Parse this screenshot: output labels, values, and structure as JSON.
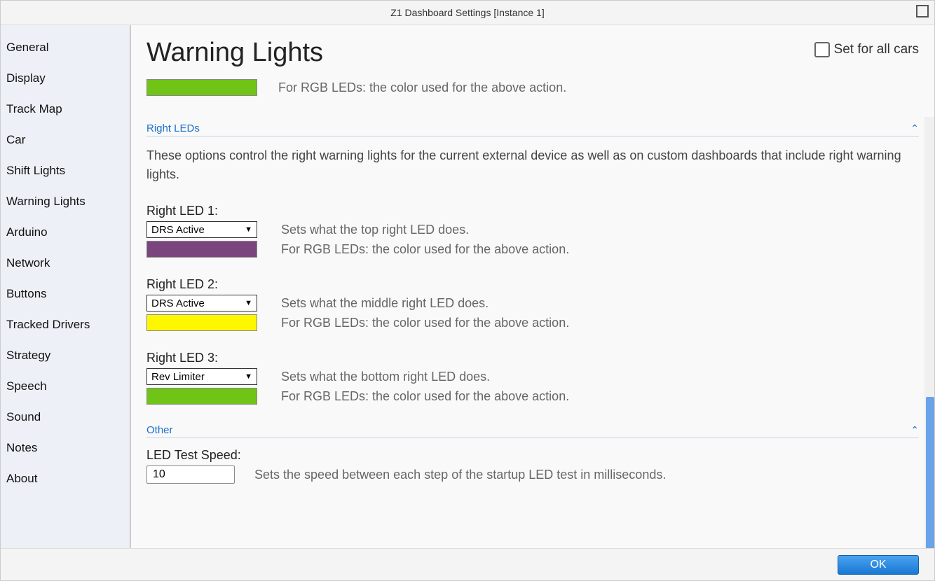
{
  "window": {
    "title": "Z1 Dashboard Settings [Instance 1]"
  },
  "sidebar": {
    "items": [
      {
        "label": "General"
      },
      {
        "label": "Display"
      },
      {
        "label": "Track Map"
      },
      {
        "label": "Car"
      },
      {
        "label": "Shift Lights"
      },
      {
        "label": "Warning Lights"
      },
      {
        "label": "Arduino"
      },
      {
        "label": "Network"
      },
      {
        "label": "Buttons"
      },
      {
        "label": "Tracked Drivers"
      },
      {
        "label": "Strategy"
      },
      {
        "label": "Speech"
      },
      {
        "label": "Sound"
      },
      {
        "label": "Notes"
      },
      {
        "label": "About"
      }
    ]
  },
  "header": {
    "title": "Warning Lights",
    "set_all_label": "Set for all cars"
  },
  "top_row": {
    "color": "#6fc415",
    "desc": "For RGB LEDs: the color used for the above action."
  },
  "right_leds": {
    "section_title": "Right LEDs",
    "intro": "These options control the right warning lights for the current external device as well as on custom dashboards that include right warning lights.",
    "items": [
      {
        "label": "Right LED 1:",
        "value": "DRS Active",
        "desc1": "Sets what the top right LED does.",
        "desc2": "For RGB LEDs: the color used for the above action.",
        "color": "#7a457d"
      },
      {
        "label": "Right LED 2:",
        "value": "DRS Active",
        "desc1": "Sets what the middle right LED does.",
        "desc2": "For RGB LEDs: the color used for the above action.",
        "color": "#fff700"
      },
      {
        "label": "Right LED 3:",
        "value": "Rev Limiter",
        "desc1": "Sets what the bottom right LED does.",
        "desc2": "For RGB LEDs: the color used for the above action.",
        "color": "#6fc415"
      }
    ]
  },
  "other": {
    "section_title": "Other",
    "led_test_label": "LED Test Speed:",
    "led_test_value": "10",
    "led_test_desc": "Sets the speed between each step of the startup LED test in milliseconds."
  },
  "footer": {
    "ok_label": "OK"
  }
}
